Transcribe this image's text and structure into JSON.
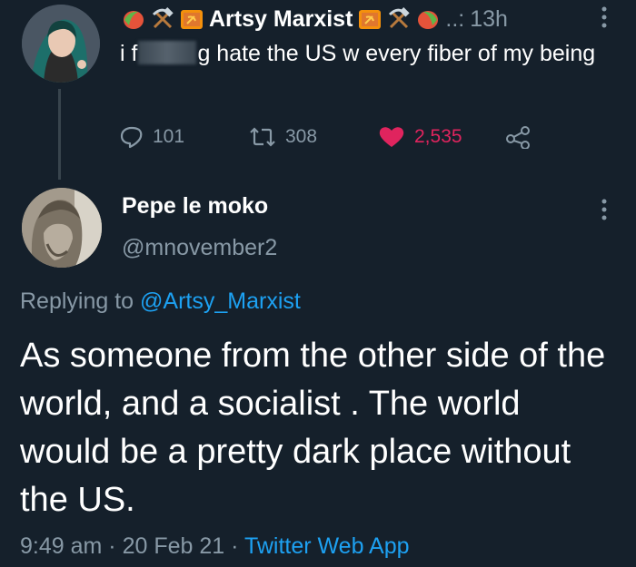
{
  "tweet1": {
    "user": {
      "name": "Artsy Marxist",
      "dots": "..:",
      "time": "13h"
    },
    "text_prefix": "i f",
    "text_suffix": "g hate the US w every fiber of my being",
    "stats": {
      "replies": "101",
      "retweets": "308",
      "likes": "2,535"
    },
    "icons": [
      "mango-icon",
      "hammer-pick-icon",
      "hammer-sickle-flag-icon",
      "reply-icon",
      "retweet-icon",
      "heart-icon",
      "share-icon",
      "more-icon"
    ]
  },
  "tweet2": {
    "user": {
      "name": "Pepe le moko",
      "handle": "@mnovember2"
    },
    "replying_label": "Replying to",
    "replying_handle": "@Artsy_Marxist",
    "text": "As someone from the other side of the world, and a socialist . The world would be a pretty dark place without the US.",
    "time": "9:49 am",
    "date": "20 Feb 21",
    "separator": "·",
    "source": "Twitter Web App"
  },
  "colors": {
    "background": "#15202b",
    "muted": "#8899a6",
    "link": "#1da1f2",
    "like": "#e0245e",
    "divider": "#38444d"
  }
}
